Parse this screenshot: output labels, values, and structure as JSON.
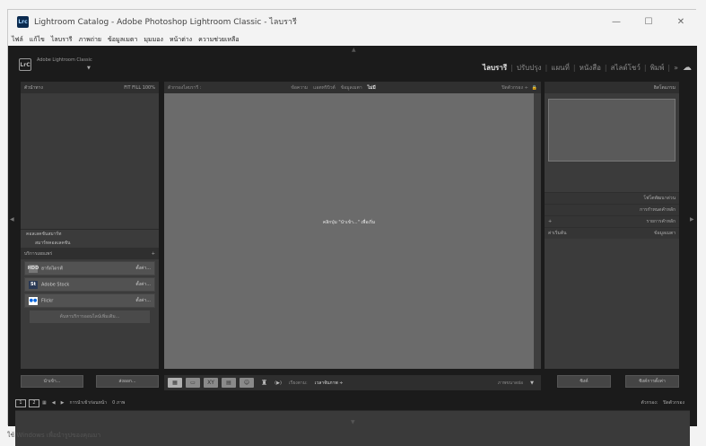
{
  "window": {
    "title": "Lightroom Catalog - Adobe Photoshop Lightroom Classic - ไลบรารี",
    "app_icon": "Lrc",
    "controls": {
      "minimize": "—",
      "maximize": "☐",
      "close": "✕"
    }
  },
  "menubar": [
    "ไฟล์",
    "แก้ไข",
    "ไลบรารี",
    "ภาพถ่าย",
    "ข้อมูลเมตา",
    "มุมมอง",
    "หน้าต่าง",
    "ความช่วยเหลือ"
  ],
  "identity": {
    "plate": "LrC",
    "text": "Adobe Lightroom Classic",
    "caret": "▼"
  },
  "modules": [
    {
      "label": "ไลบรารี",
      "active": true
    },
    {
      "label": "ปรับปรุง",
      "active": false
    },
    {
      "label": "แผนที่",
      "active": false
    },
    {
      "label": "หนังสือ",
      "active": false
    },
    {
      "label": "สไลด์โชว์",
      "active": false
    },
    {
      "label": "พิมพ์",
      "active": false
    }
  ],
  "modules_more": "»",
  "left_panel": {
    "navigator": {
      "title": "ตัวนำทาง",
      "zooms": "FIT   FILL   100%"
    },
    "collections": [
      {
        "label": "คอลเลคชันสมาร์ท"
      },
      {
        "label": "สมาร์ทคอลเลคชัน"
      }
    ],
    "publish_header": "บริการเผยแพร่",
    "publish_plus": "+",
    "services": [
      {
        "icon_text": "HDD",
        "label": "ฮาร์ดไดรฟ์",
        "action": "ตั้งค่า...",
        "color": "#777777"
      },
      {
        "icon_text": "St",
        "label": "Adobe Stock",
        "action": "ตั้งค่า...",
        "color": "#2b3a55"
      },
      {
        "icon_text": "●●",
        "label": "Flickr",
        "action": "ตั้งค่า...",
        "color": "#ffffff"
      }
    ],
    "find_more": "ค้นหาบริการออนไลน์เพิ่มเติม..."
  },
  "left_buttons": {
    "import": "นำเข้า...",
    "export": "ส่งออก..."
  },
  "filter_bar": {
    "title": "ตัวกรองไลบรารี :",
    "options": [
      "ข้อความ",
      "แอตทริบิวต์",
      "ข้อมูลเมตา",
      "ไม่มี"
    ],
    "active": "ไม่มี",
    "preset": "ปิดตัวกรอง ÷"
  },
  "grid": {
    "message": "คลิกปุ่ม \"นำเข้า...\" เพื่อเริ่ม"
  },
  "toolbar": {
    "sort_label": "เรียงตาม:",
    "sort_value": "เวลาจับภาพ ÷",
    "thumb_label": "ภาพขนาดย่อ"
  },
  "right_panel": {
    "header": "ฮิสโตแกรม",
    "quick_develop": "โฟโตพัฒนาด่วน",
    "keywording": "การกำหนดคำหลัก",
    "keyword_list": "รายการคำหลัก",
    "metadata_preset": "ค่าเริ่มต้น",
    "metadata": "ข้อมูลเมตา"
  },
  "right_buttons": {
    "sync": "ซิงค์",
    "sync_settings": "ซิงค์การตั้งค่า"
  },
  "filmstrip": {
    "monitor1": "1",
    "monitor2": "2",
    "source": "การนำเข้าก่อนหน้า",
    "count": "0 ภาพ",
    "filter_label": "ตัวกรอง:",
    "filter_value": "ปิดตัวกรอง"
  },
  "taskbar_text": "ใช้ Windows เพื่อนำรูปของคุณมา"
}
